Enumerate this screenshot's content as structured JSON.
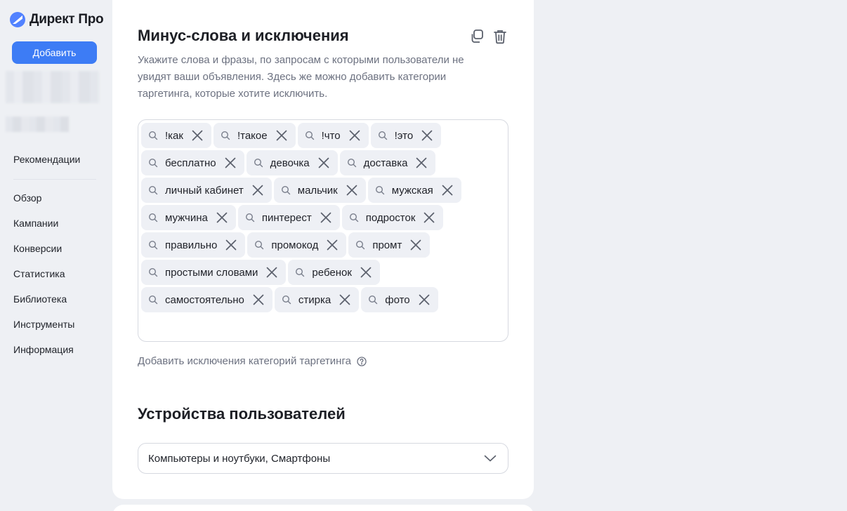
{
  "app": {
    "title": "Директ Про"
  },
  "sidebar": {
    "add_button": "Добавить",
    "items": [
      {
        "label": "Рекомендации"
      },
      {
        "label": "Обзор"
      },
      {
        "label": "Кампании"
      },
      {
        "label": "Конверсии"
      },
      {
        "label": "Статистика"
      },
      {
        "label": "Библиотека"
      },
      {
        "label": "Инструменты"
      },
      {
        "label": "Информация"
      }
    ]
  },
  "minus_words": {
    "title": "Минус-слова и исключения",
    "description": "Укажите слова и фразы, по запросам с которыми пользователи не увидят ваши объявления. Здесь же можно добавить категории таргетинга, которые хотите исключить.",
    "words": [
      "!как",
      "!такое",
      "!что",
      "!это",
      "бесплатно",
      "девочка",
      "доставка",
      "личный кабинет",
      "мальчик",
      "мужская",
      "мужчина",
      "пинтерест",
      "подросток",
      "правильно",
      "промокод",
      "промт",
      "простыми словами",
      "ребенок",
      "самостоятельно",
      "стирка",
      "фото"
    ],
    "exclude_link": "Добавить исключения категорий таргетинга"
  },
  "devices": {
    "title": "Устройства пользователей",
    "selected": "Компьютеры и ноутбуки, Смартфоны"
  },
  "colors": {
    "accent": "#3d7cf5",
    "tag_bg": "#eef0f5",
    "page_bg": "#eef0f4",
    "muted_text": "#6c7180"
  }
}
